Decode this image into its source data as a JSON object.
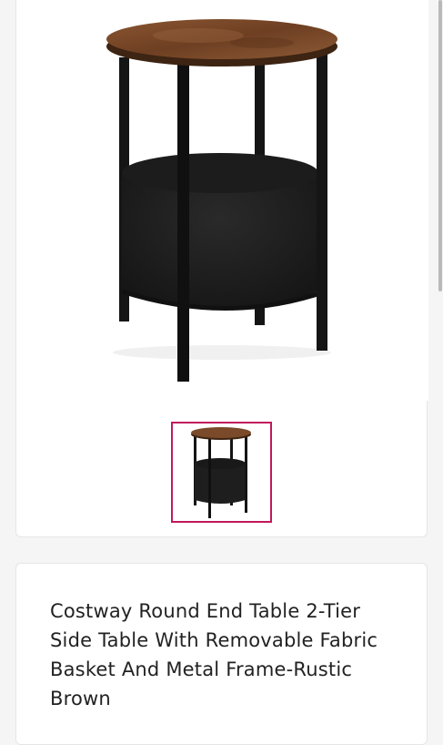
{
  "product": {
    "title": "Costway Round End Table 2-Tier Side Table With Removable Fabric Basket And Metal Frame-Rustic Brown",
    "main_image": "side-table-product-image",
    "thumbnails": [
      {
        "icon": "side-table-thumbnail",
        "selected": true
      }
    ]
  },
  "colors": {
    "thumbnail_border": "#c2185b",
    "tabletop": "#7a4a2a",
    "frame": "#151515",
    "basket": "#222222"
  }
}
